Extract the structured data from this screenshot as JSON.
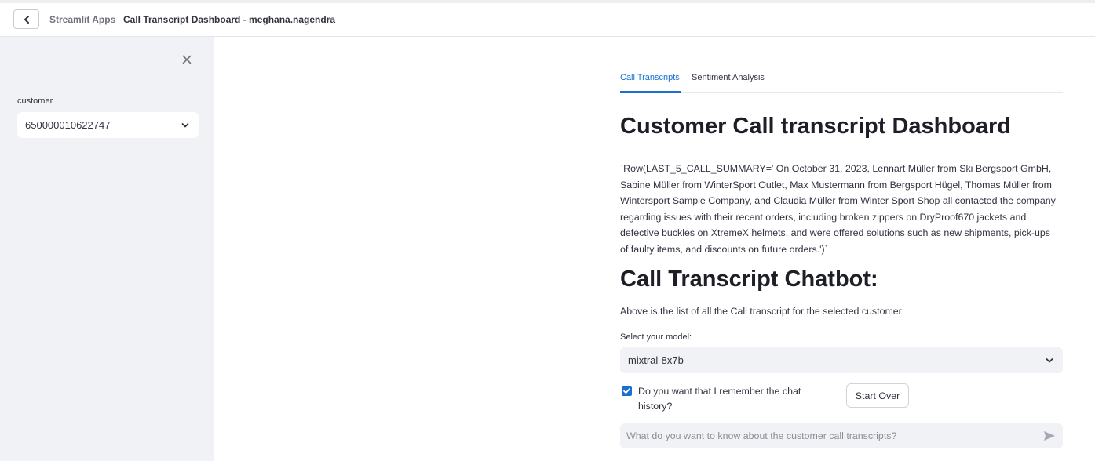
{
  "topbar": {
    "app_label": "Streamlit Apps",
    "title": "Call Transcript Dashboard - meghana.nagendra"
  },
  "sidebar": {
    "customer_label": "customer",
    "customer_value": "650000010622747"
  },
  "tabs": [
    {
      "label": "Call Transcripts",
      "active": true
    },
    {
      "label": "Sentiment Analysis",
      "active": false
    }
  ],
  "main": {
    "title": "Customer Call transcript Dashboard",
    "summary": "`Row(LAST_5_CALL_SUMMARY=' On October 31, 2023, Lennart Müller from Ski Bergsport GmbH, Sabine Müller from WinterSport Outlet, Max Mustermann from Bergsport Hügel, Thomas Müller from Wintersport Sample Company, and Claudia Müller from Winter Sport Shop all contacted the company regarding issues with their recent orders, including broken zippers on DryProof670 jackets and defective buckles on XtremeX helmets, and were offered solutions such as new shipments, pick-ups of faulty items, and discounts on future orders.')`",
    "chatbot_title": "Call Transcript Chatbot:",
    "intro": "Above is the list of all the Call transcript for the selected customer:",
    "model_label": "Select your model:",
    "model_value": "mixtral-8x7b",
    "remember_label": "Do you want that I remember the chat history?",
    "remember_checked": true,
    "start_over_label": "Start Over",
    "chat_placeholder": "What do you want to know about the customer call transcripts?"
  },
  "colors": {
    "accent": "#1c6fd1",
    "sidebar_bg": "#f0f2f6",
    "text": "#31333f"
  },
  "icons": [
    "chevron-left-icon",
    "caret-down-icon",
    "close-icon",
    "chevron-down-icon",
    "checkbox-checked-icon",
    "send-icon"
  ]
}
